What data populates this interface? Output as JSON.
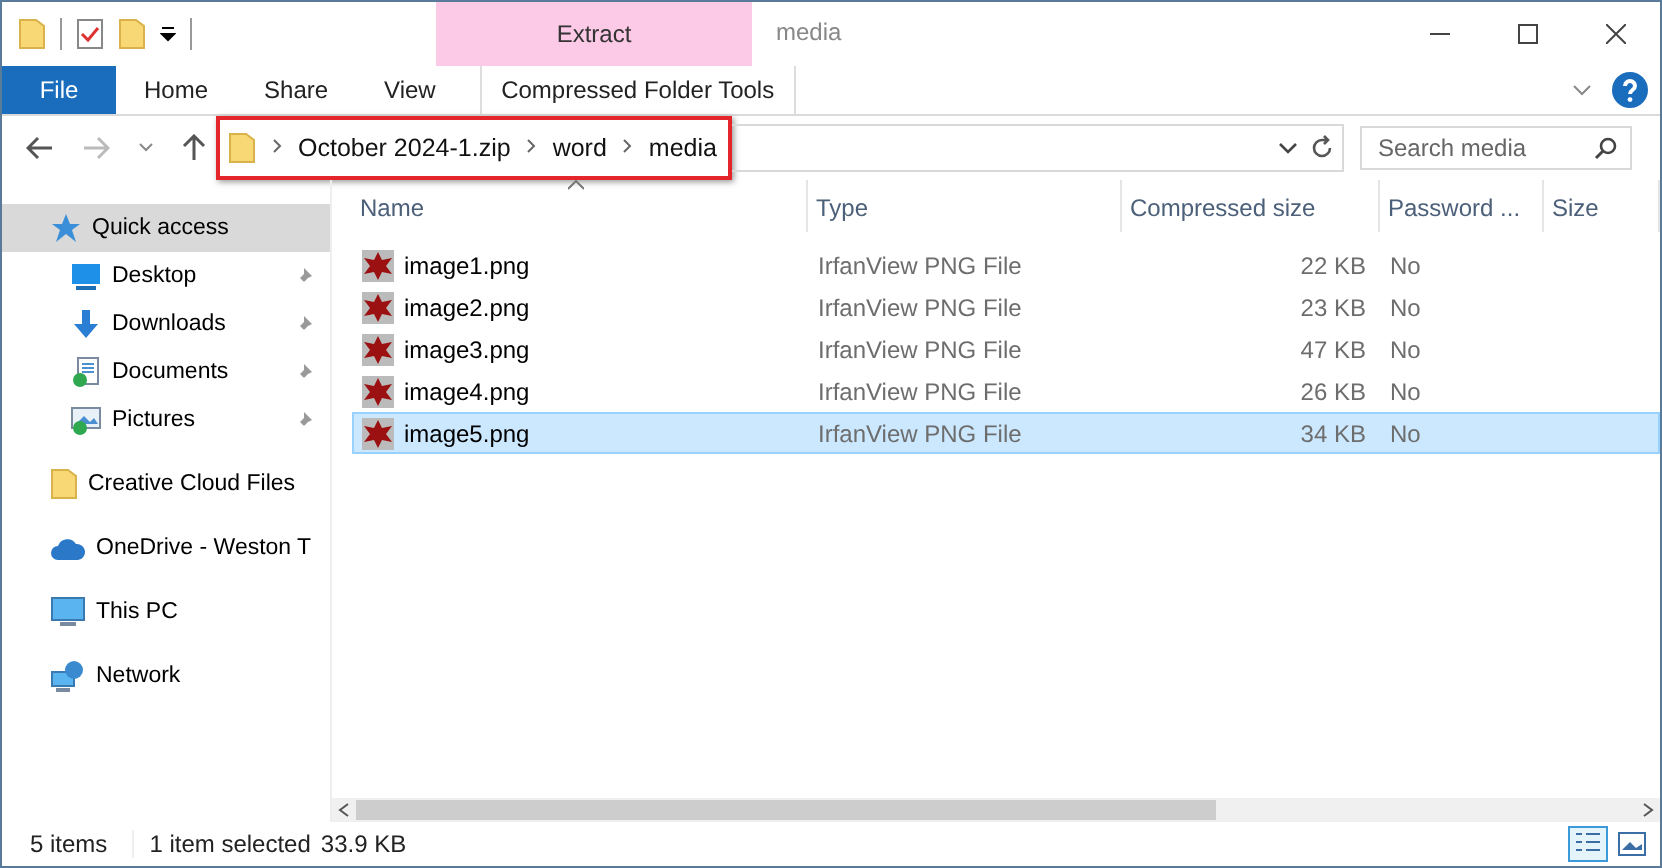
{
  "window": {
    "title": "media"
  },
  "ribbon": {
    "context_group": "Extract",
    "tabs": [
      {
        "label": "File",
        "kind": "file"
      },
      {
        "label": "Home",
        "kind": "plain"
      },
      {
        "label": "Share",
        "kind": "plain"
      },
      {
        "label": "View",
        "kind": "plain"
      },
      {
        "label": "Compressed Folder Tools",
        "kind": "context"
      }
    ]
  },
  "breadcrumb": [
    "October 2024-1.zip",
    "word",
    "media"
  ],
  "search": {
    "placeholder": "Search media"
  },
  "sidebar": {
    "items": [
      {
        "label": "Quick access",
        "kind": "star",
        "selected": true,
        "pinned": false,
        "children": [
          {
            "label": "Desktop",
            "kind": "desktop",
            "selected": false,
            "pinned": true
          },
          {
            "label": "Downloads",
            "kind": "download",
            "selected": false,
            "pinned": true
          },
          {
            "label": "Documents",
            "kind": "documents",
            "selected": false,
            "pinned": true
          },
          {
            "label": "Pictures",
            "kind": "pictures",
            "selected": false,
            "pinned": true
          }
        ]
      },
      {
        "label": "Creative Cloud Files",
        "kind": "folder",
        "selected": false,
        "pinned": false
      },
      {
        "label": "OneDrive - Weston T",
        "kind": "cloud",
        "selected": false,
        "pinned": false
      },
      {
        "label": "This PC",
        "kind": "pc",
        "selected": false,
        "pinned": false
      },
      {
        "label": "Network",
        "kind": "network",
        "selected": false,
        "pinned": false
      }
    ]
  },
  "table": {
    "columns": [
      "Name",
      "Type",
      "Compressed size",
      "Password ...",
      "Size"
    ],
    "rows": [
      {
        "cells": [
          "image1.png",
          "IrfanView PNG File",
          "22 KB",
          "No"
        ],
        "selected": false
      },
      {
        "cells": [
          "image2.png",
          "IrfanView PNG File",
          "23 KB",
          "No"
        ],
        "selected": false
      },
      {
        "cells": [
          "image3.png",
          "IrfanView PNG File",
          "47 KB",
          "No"
        ],
        "selected": false
      },
      {
        "cells": [
          "image4.png",
          "IrfanView PNG File",
          "26 KB",
          "No"
        ],
        "selected": false
      },
      {
        "cells": [
          "image5.png",
          "IrfanView PNG File",
          "34 KB",
          "No"
        ],
        "selected": true
      }
    ]
  },
  "status_bar": {
    "item_count": "5 items",
    "selection": "1 item selected",
    "selection_size": "33.9 KB"
  },
  "view_buttons": [
    {
      "kind": "details",
      "selected": true
    },
    {
      "kind": "preview",
      "selected": false
    }
  ]
}
